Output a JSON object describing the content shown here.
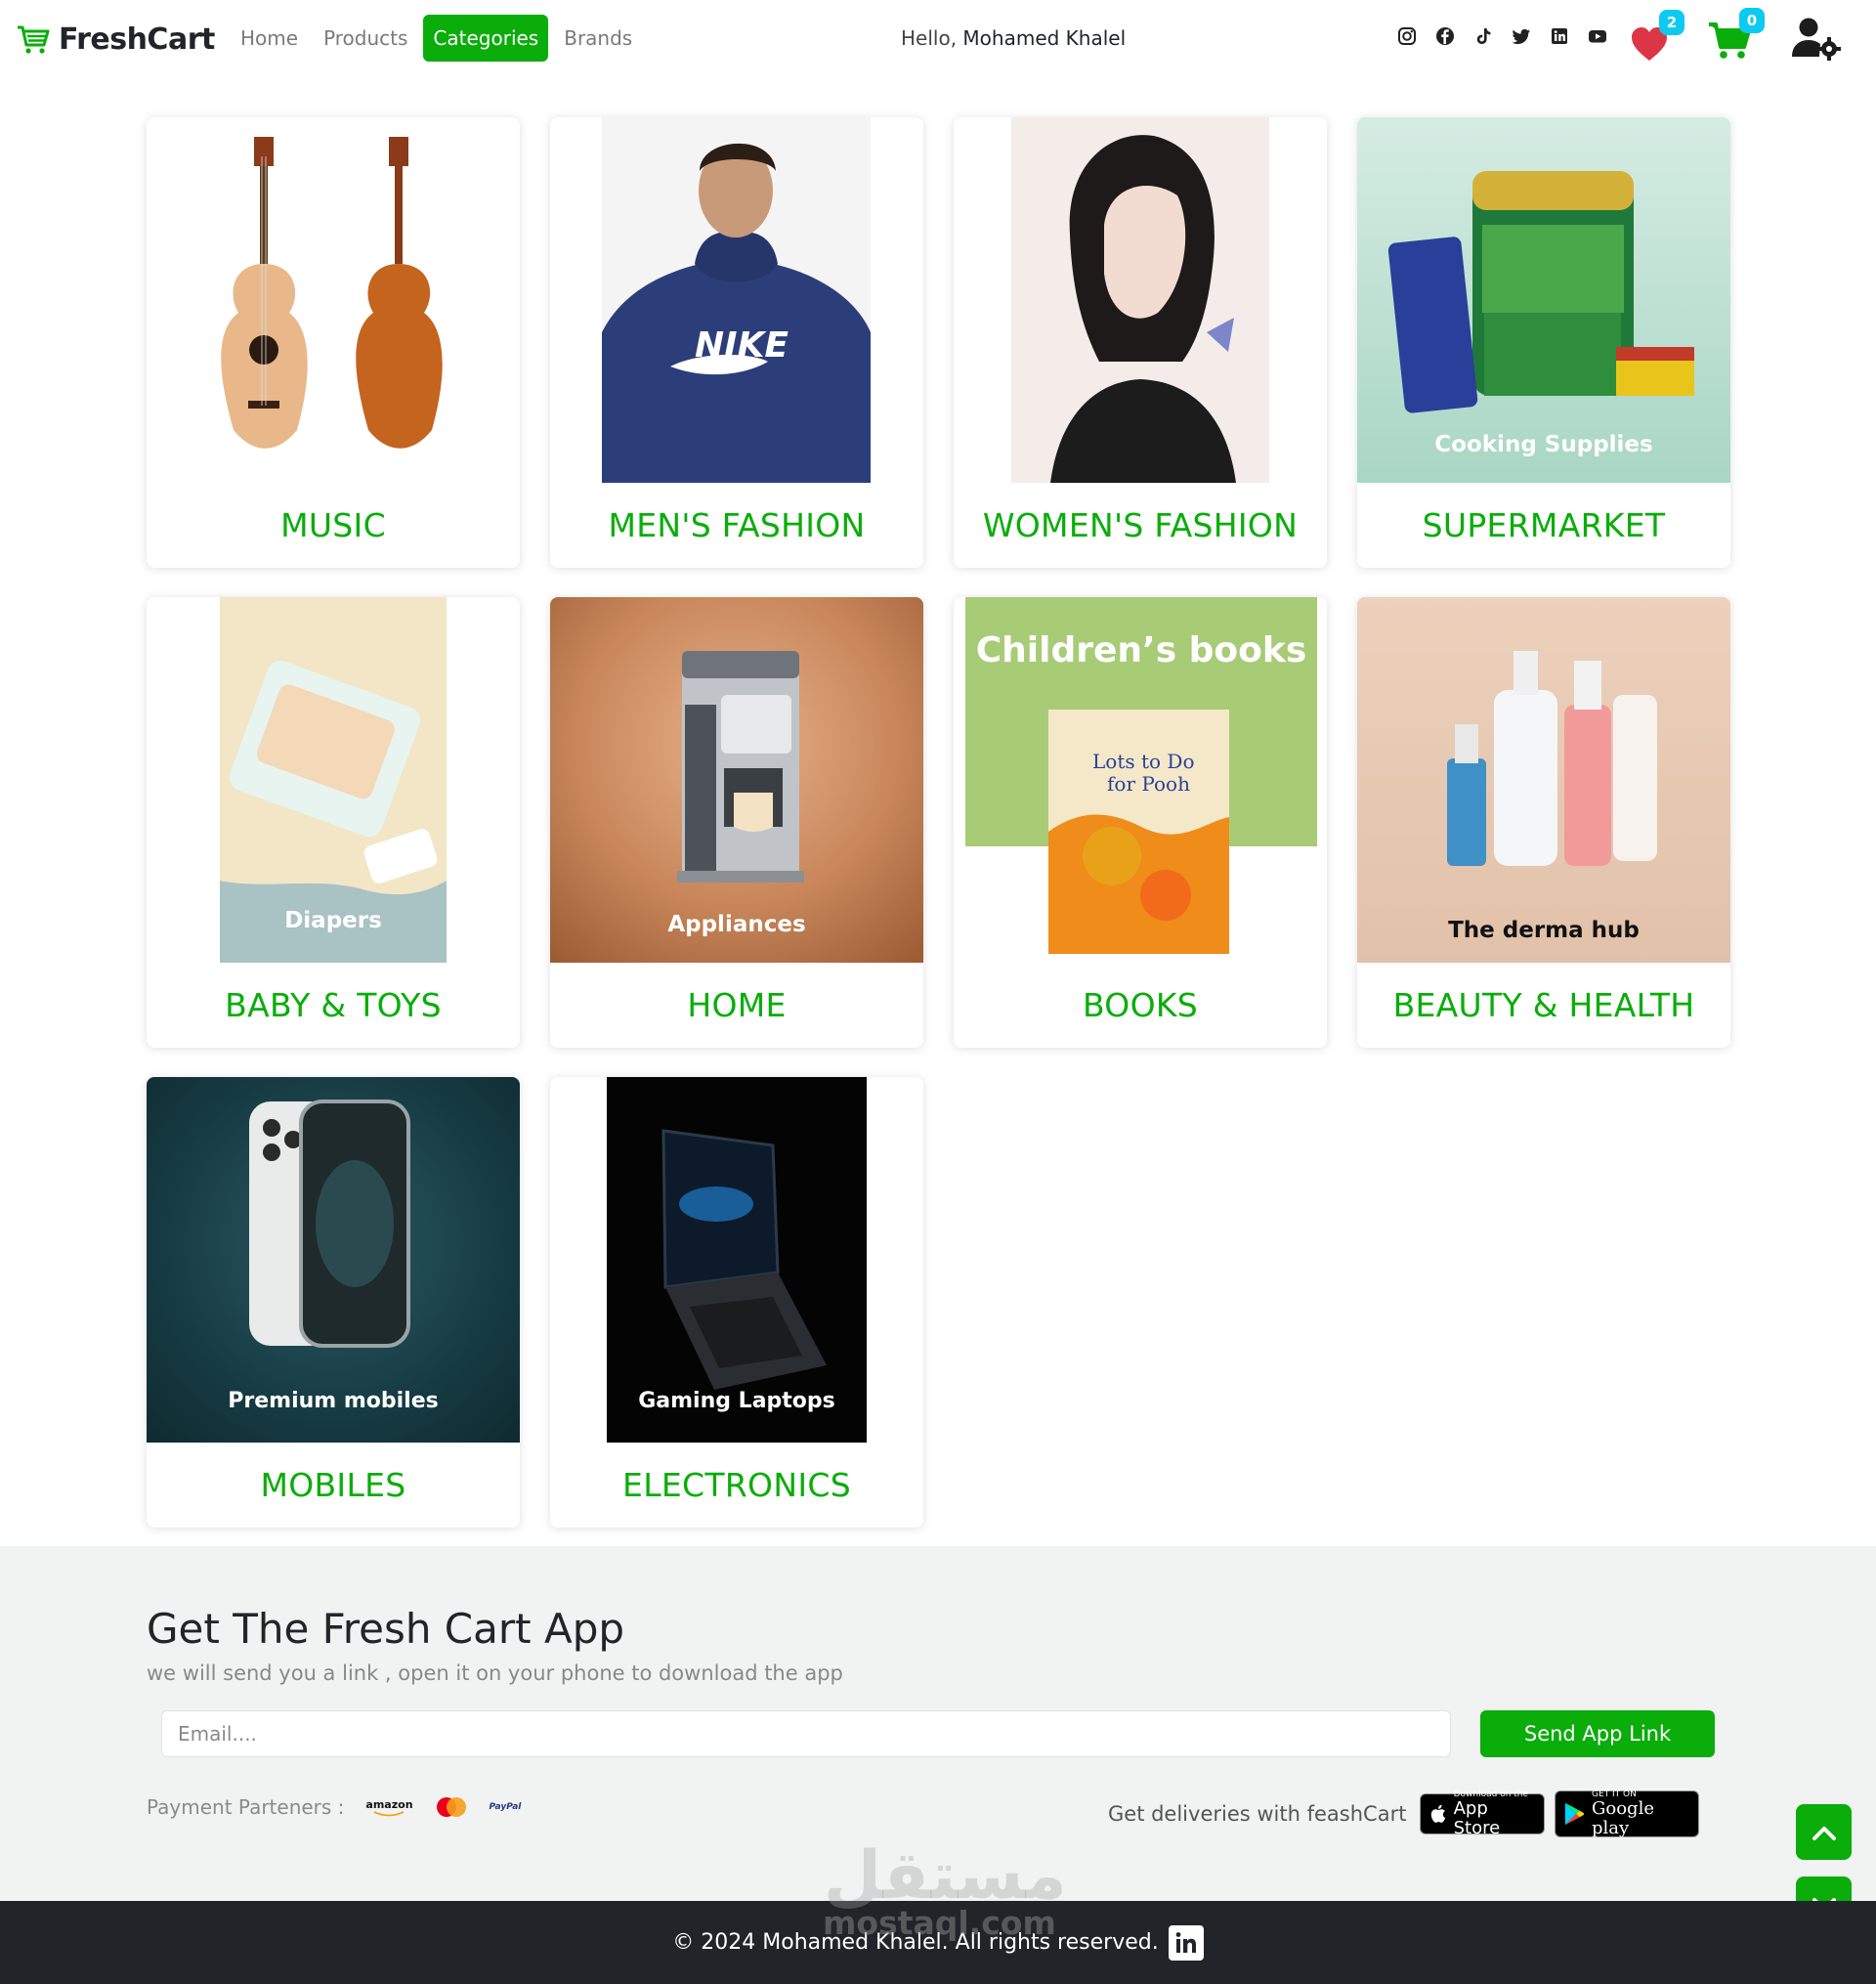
{
  "brand": {
    "name": "FreshCart"
  },
  "nav": {
    "links": [
      "Home",
      "Products",
      "Categories",
      "Brands"
    ],
    "active": "Categories"
  },
  "greeting": {
    "prefix": "Hello,",
    "user": "Mohamed Khalel"
  },
  "socials": [
    "instagram-icon",
    "facebook-icon",
    "tiktok-icon",
    "twitter-icon",
    "linkedin-icon",
    "youtube-icon"
  ],
  "wishlist": {
    "count": "2"
  },
  "cart": {
    "count": "0"
  },
  "categories": [
    {
      "name": "MUSIC",
      "image_text": ""
    },
    {
      "name": "MEN'S FASHION",
      "image_text": ""
    },
    {
      "name": "WOMEN'S FASHION",
      "image_text": ""
    },
    {
      "name": "SUPERMARKET",
      "image_text": "Cooking Supplies"
    },
    {
      "name": "BABY & TOYS",
      "image_text": "Diapers"
    },
    {
      "name": "HOME",
      "image_text": "Appliances"
    },
    {
      "name": "BOOKS",
      "image_text": "Children’s books"
    },
    {
      "name": "BEAUTY & HEALTH",
      "image_text": "The derma hub"
    },
    {
      "name": "MOBILES",
      "image_text": "Premium mobiles"
    },
    {
      "name": "ELECTRONICS",
      "image_text": "Gaming Laptops"
    }
  ],
  "app_section": {
    "title": "Get The Fresh Cart App",
    "subtitle": "we will send you a link , open it on your phone to download the app",
    "email_placeholder": "Email....",
    "send_button": "Send App Link",
    "partners_label": "Payment Parteners :",
    "partners": [
      "amazon",
      "PayPal"
    ],
    "delivery_label": "Get deliveries with feashCart",
    "app_store": {
      "small": "Download on the",
      "big": "App Store"
    },
    "google_play": {
      "small": "GET IT ON",
      "big": "Google play"
    }
  },
  "footer": {
    "text": "© 2024 Mohamed Khalel. All rights reserved."
  },
  "watermark": {
    "arabic": "مستقل",
    "latin": "mostaql.com"
  },
  "colors": {
    "accent": "#0aad0a",
    "badge": "#0dcaf0",
    "heart": "#dc3545",
    "footer_bg": "#212529",
    "section_bg": "#f0f3f2"
  }
}
